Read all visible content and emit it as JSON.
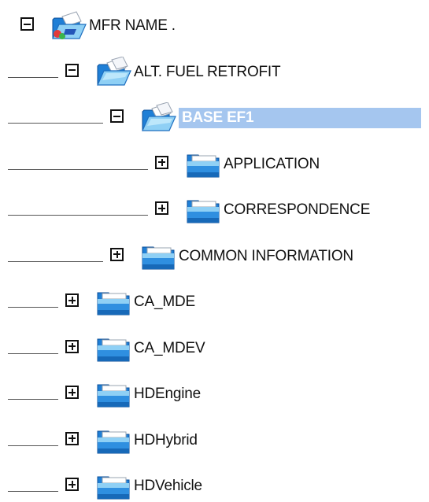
{
  "tree": {
    "nodes": [
      {
        "label": "MFR NAME .",
        "depth": 0,
        "expanded": true,
        "icon": "open-folder-root-icon",
        "selected": false
      },
      {
        "label": "ALT. FUEL RETROFIT",
        "depth": 1,
        "expanded": true,
        "icon": "open-folder-icon",
        "selected": false
      },
      {
        "label": "BASE EF1",
        "depth": 2,
        "expanded": true,
        "icon": "open-folder-icon",
        "selected": true
      },
      {
        "label": "APPLICATION",
        "depth": 3,
        "expanded": false,
        "icon": "closed-folder-icon",
        "selected": false
      },
      {
        "label": "CORRESPONDENCE",
        "depth": 3,
        "expanded": false,
        "icon": "closed-folder-icon",
        "selected": false
      },
      {
        "label": "COMMON INFORMATION",
        "depth": 2,
        "expanded": false,
        "icon": "closed-folder-icon",
        "selected": false
      },
      {
        "label": "CA_MDE",
        "depth": 1,
        "expanded": false,
        "icon": "closed-folder-icon",
        "selected": false
      },
      {
        "label": "CA_MDEV",
        "depth": 1,
        "expanded": false,
        "icon": "closed-folder-icon",
        "selected": false
      },
      {
        "label": "HDEngine",
        "depth": 1,
        "expanded": false,
        "icon": "closed-folder-icon",
        "selected": false
      },
      {
        "label": "HDHybrid",
        "depth": 1,
        "expanded": false,
        "icon": "closed-folder-icon",
        "selected": false
      },
      {
        "label": "HDVehicle",
        "depth": 1,
        "expanded": false,
        "icon": "closed-folder-icon",
        "selected": false
      }
    ]
  },
  "colors": {
    "selection_background": "#a5c6ef",
    "folder_blue": "#1f7fd6",
    "folder_light": "#8fd0f5"
  }
}
